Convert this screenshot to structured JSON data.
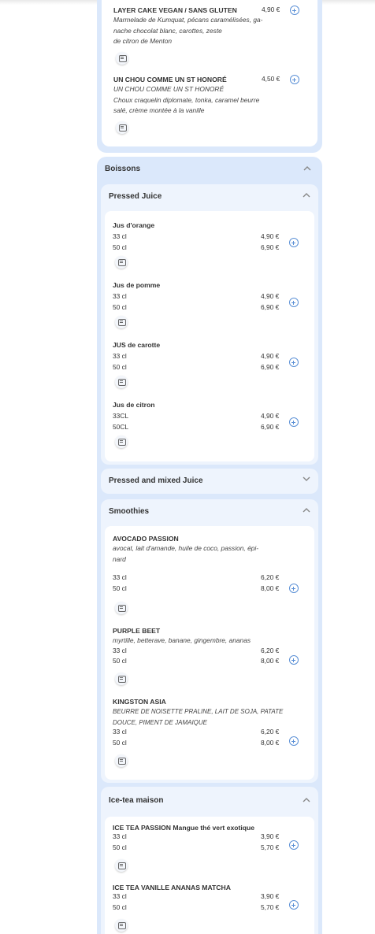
{
  "cakes": {
    "items": [
      {
        "name": "LAYER CAKE VEGAN / SANS GLUTEN",
        "price": "4,90 €",
        "desc": [
          "Marmelade de Kumquat, pécans caramélisées, ga-",
          "nache chocolat blanc, carottes, zeste",
          "de citron de Menton"
        ]
      },
      {
        "name": "UN CHOU COMME UN ST HONORÉ",
        "price": "4,50 €",
        "desc": [
          "UN CHOU COMME UN ST HONORÉ",
          " Choux craquelin diplomate, tonka, caramel beurre",
          "salé, crème montée à la vanille"
        ]
      }
    ]
  },
  "drinks": {
    "title": "Boissons",
    "categories": {
      "pressed": {
        "title": "Pressed Juice",
        "items": [
          {
            "name": "Jus d'orange",
            "sizes": [
              "33 cl",
              "50 cl"
            ],
            "prices": [
              "4,90 €",
              "6,90 €"
            ]
          },
          {
            "name": "Jus de pomme",
            "sizes": [
              "33 cl",
              "50 cl"
            ],
            "prices": [
              "4,90 €",
              "6,90 €"
            ]
          },
          {
            "name": "JUS de carotte",
            "sizes": [
              "33 cl",
              "50 cl"
            ],
            "prices": [
              "4,90 €",
              "6,90 €"
            ]
          },
          {
            "name": "Jus de citron",
            "sizes": [
              "33CL",
              "50CL"
            ],
            "prices": [
              "4,90 €",
              "6,90 €"
            ]
          }
        ]
      },
      "mixed": {
        "title": "Pressed and mixed Juice"
      },
      "smoothies": {
        "title": "Smoothies",
        "items": [
          {
            "name": "AVOCADO PASSION",
            "desc": [
              "avocat, lait d'amande, huile de coco, passion, épi-",
              "nard"
            ],
            "sizes": [
              "33 cl",
              "50 cl"
            ],
            "prices": [
              "6,20 €",
              "8,00 €"
            ]
          },
          {
            "name": "PURPLE BEET",
            "desc": [
              "myrtille, betterave, banane, gingembre, ananas"
            ],
            "sizes": [
              "33 cl",
              "50 cl"
            ],
            "prices": [
              "6,20 €",
              "8,00 €"
            ]
          },
          {
            "name": "KINGSTON ASIA",
            "desc": [
              "BEURRE DE NOISETTE PRALINE, LAIT DE SOJA, PATATE",
              "DOUCE, PIMENT DE JAMAIQUE"
            ],
            "sizes": [
              "33 cl",
              "50 cl"
            ],
            "prices": [
              "6,20 €",
              "8,00 €"
            ]
          }
        ]
      },
      "icetea": {
        "title": "Ice-tea maison",
        "items": [
          {
            "name": "ICE TEA PASSION Mangue thé vert exotique",
            "sizes": [
              "33 cl",
              "50 cl"
            ],
            "prices": [
              "3,90 €",
              "5,70 €"
            ]
          },
          {
            "name": "ICE TEA VANILLE ANANAS MATCHA",
            "sizes": [
              "33 cl",
              "50 cl"
            ],
            "prices": [
              "3,90 €",
              "5,70 €"
            ]
          }
        ]
      }
    }
  },
  "icons": {
    "add": "plus-circle-icon",
    "allergen": "allergen-info-icon",
    "expand": "chevron-up-icon",
    "collapsed": "chevron-down-icon"
  },
  "colors": {
    "accent": "#5b90d6",
    "section_bg": "#dbe8fb",
    "category_bg": "#eef4fd"
  }
}
